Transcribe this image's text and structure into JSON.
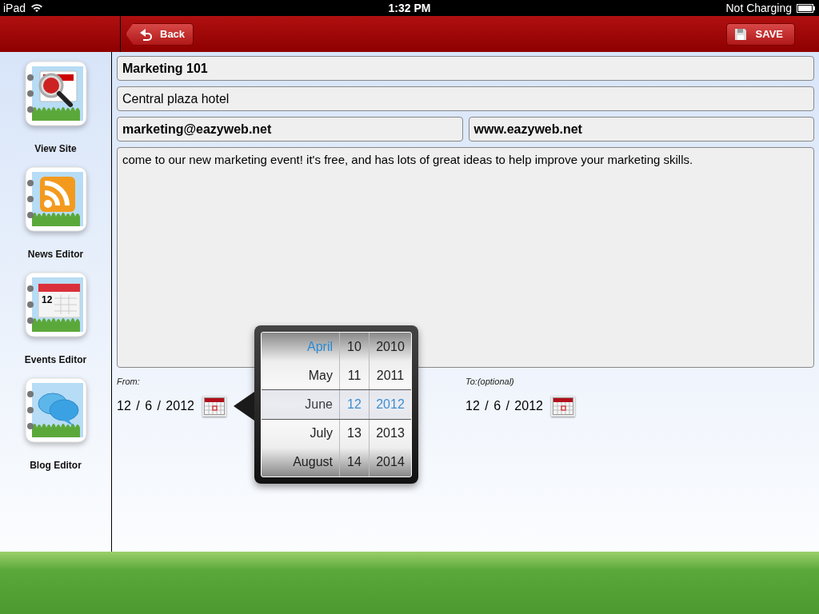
{
  "status_bar": {
    "carrier": "iPad",
    "time": "1:32 PM",
    "battery_status": "Not Charging"
  },
  "toolbar": {
    "back": "Back",
    "save": "SAVE"
  },
  "sidebar": {
    "items": [
      {
        "label": "View Site",
        "kind": "site"
      },
      {
        "label": "News Editor",
        "kind": "rss"
      },
      {
        "label": "Events Editor",
        "kind": "calendar",
        "icon_text": "12"
      },
      {
        "label": "Blog Editor",
        "kind": "chat"
      }
    ]
  },
  "form": {
    "title": "Marketing 101",
    "location": "Central plaza hotel",
    "email": "marketing@eazyweb.net",
    "website": "www.eazyweb.net",
    "description": "come to our new marketing event! it's free, and has lots of great ideas to help improve your marketing skills.",
    "from": {
      "label": "From:",
      "date": "12 / 6 / 2012"
    },
    "to": {
      "label": "To:(optional)",
      "date": "12 / 6 / 2012"
    }
  },
  "date_picker": {
    "columns": [
      {
        "kind": "month",
        "items": [
          {
            "label": "April",
            "highlighted": true
          },
          {
            "label": "May",
            "highlighted": false
          },
          {
            "label": "June",
            "highlighted": false
          },
          {
            "label": "July",
            "highlighted": false
          },
          {
            "label": "August",
            "highlighted": false
          }
        ]
      },
      {
        "kind": "day",
        "items": [
          {
            "label": "10",
            "highlighted": false
          },
          {
            "label": "11",
            "highlighted": false
          },
          {
            "label": "12",
            "highlighted": true
          },
          {
            "label": "13",
            "highlighted": false
          },
          {
            "label": "14",
            "highlighted": false
          }
        ]
      },
      {
        "kind": "year",
        "items": [
          {
            "label": "2010",
            "highlighted": false
          },
          {
            "label": "2011",
            "highlighted": false
          },
          {
            "label": "2012",
            "highlighted": true
          },
          {
            "label": "2013",
            "highlighted": false
          },
          {
            "label": "2014",
            "highlighted": false
          }
        ]
      }
    ]
  }
}
